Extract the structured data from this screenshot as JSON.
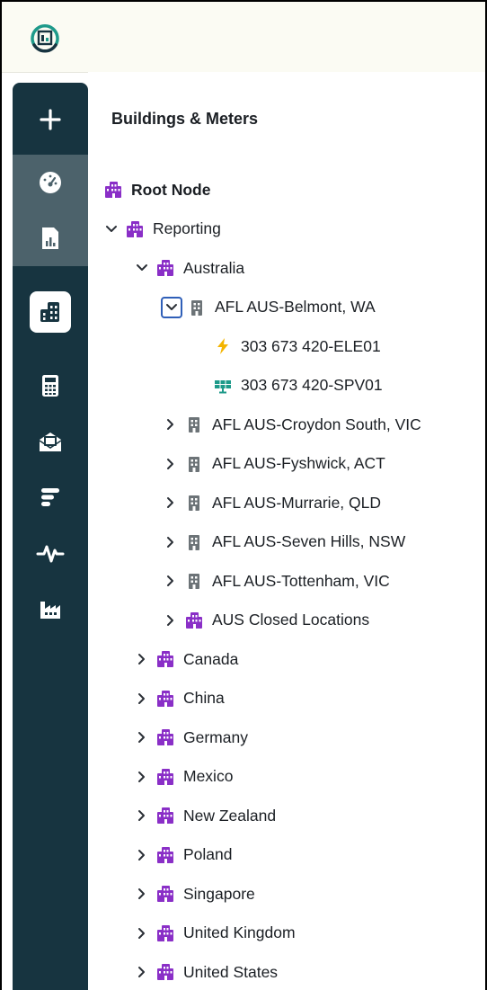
{
  "colors": {
    "nav_bg": "#173440",
    "nav_highlight": "#4c626b",
    "building_purple": "#8a2fc7",
    "building_gray": "#6c7377",
    "electric": "#f4b400",
    "solar": "#1e9a8a",
    "focus": "#2f5fb8"
  },
  "sidebar": {
    "items": [
      {
        "icon": "plus-icon"
      },
      {
        "icon": "gauge-icon"
      },
      {
        "icon": "report-icon"
      },
      {
        "icon": "buildings-icon"
      },
      {
        "icon": "calculator-icon"
      },
      {
        "icon": "mail-clipboard-icon"
      },
      {
        "icon": "list-icon"
      },
      {
        "icon": "pulse-icon"
      },
      {
        "icon": "factory-icon"
      }
    ]
  },
  "panel": {
    "title": "Buildings & Meters"
  },
  "tree": [
    {
      "label": "Root Node",
      "level": 0,
      "chevron": "none",
      "icon": "building-group-icon"
    },
    {
      "label": "Reporting",
      "level": 1,
      "chevron": "down",
      "icon": "building-group-icon"
    },
    {
      "label": "Australia",
      "level": 2,
      "chevron": "down",
      "icon": "building-group-icon"
    },
    {
      "label": "AFL AUS-Belmont, WA",
      "level": 3,
      "chevron": "down-focused",
      "icon": "building-icon"
    },
    {
      "label": "303 673 420-ELE01",
      "level": 4,
      "chevron": "none",
      "icon": "electric-meter-icon"
    },
    {
      "label": "303 673 420-SPV01",
      "level": 4,
      "chevron": "none",
      "icon": "solar-panel-icon"
    },
    {
      "label": "AFL AUS-Croydon South, VIC",
      "level": 3,
      "chevron": "right",
      "icon": "building-icon"
    },
    {
      "label": "AFL AUS-Fyshwick, ACT",
      "level": 3,
      "chevron": "right",
      "icon": "building-icon"
    },
    {
      "label": "AFL AUS-Murrarie, QLD",
      "level": 3,
      "chevron": "right",
      "icon": "building-icon"
    },
    {
      "label": "AFL AUS-Seven Hills, NSW",
      "level": 3,
      "chevron": "right",
      "icon": "building-icon"
    },
    {
      "label": "AFL AUS-Tottenham, VIC",
      "level": 3,
      "chevron": "right",
      "icon": "building-icon"
    },
    {
      "label": "AUS Closed Locations",
      "level": 3,
      "chevron": "right",
      "icon": "building-group-icon"
    },
    {
      "label": "Canada",
      "level": 2,
      "chevron": "right",
      "icon": "building-group-icon"
    },
    {
      "label": "China",
      "level": 2,
      "chevron": "right",
      "icon": "building-group-icon"
    },
    {
      "label": "Germany",
      "level": 2,
      "chevron": "right",
      "icon": "building-group-icon"
    },
    {
      "label": "Mexico",
      "level": 2,
      "chevron": "right",
      "icon": "building-group-icon"
    },
    {
      "label": "New Zealand",
      "level": 2,
      "chevron": "right",
      "icon": "building-group-icon"
    },
    {
      "label": "Poland",
      "level": 2,
      "chevron": "right",
      "icon": "building-group-icon"
    },
    {
      "label": "Singapore",
      "level": 2,
      "chevron": "right",
      "icon": "building-group-icon"
    },
    {
      "label": "United Kingdom",
      "level": 2,
      "chevron": "right",
      "icon": "building-group-icon"
    },
    {
      "label": "United States",
      "level": 2,
      "chevron": "right",
      "icon": "building-group-icon"
    }
  ]
}
